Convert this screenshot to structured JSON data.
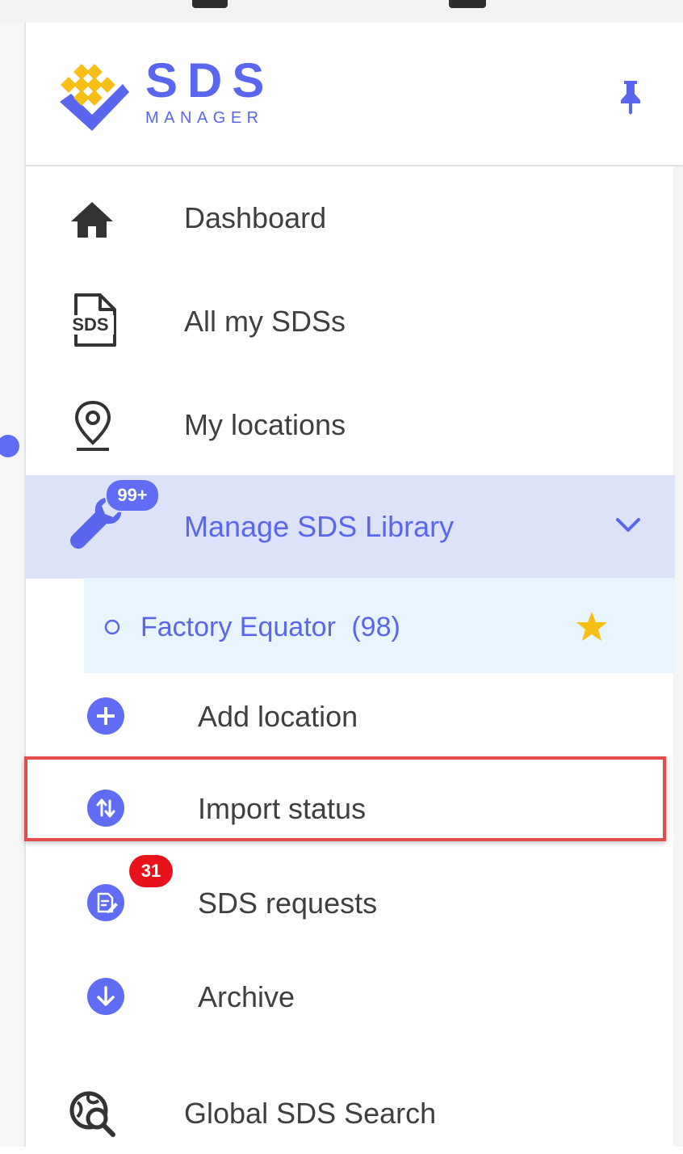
{
  "app": {
    "logo_title": "SDS",
    "logo_subtitle": "MANAGER"
  },
  "colors": {
    "accent": "#5a66ee",
    "active_bg": "#dce3f9",
    "sub_bg": "#e8f4fe",
    "highlight_border": "#e44b4b",
    "badge_red": "#e8121b",
    "star": "#f7be16"
  },
  "nav": {
    "dashboard": {
      "label": "Dashboard",
      "icon": "home-icon"
    },
    "all_sds": {
      "label": "All my SDSs",
      "icon": "sds-document-icon"
    },
    "locations": {
      "label": "My locations",
      "icon": "location-pin-icon"
    },
    "manage": {
      "label": "Manage SDS Library",
      "icon": "wrench-icon",
      "badge": "99+",
      "expanded": true
    },
    "factory": {
      "label": "Factory Equator",
      "count": "(98)",
      "favorite": true
    },
    "add_location": {
      "label": "Add location",
      "icon": "plus-circle-icon"
    },
    "import_status": {
      "label": "Import status",
      "icon": "import-arrows-icon"
    },
    "sds_requests": {
      "label": "SDS requests",
      "icon": "edit-document-icon",
      "badge": "31"
    },
    "archive": {
      "label": "Archive",
      "icon": "download-arrow-icon"
    },
    "global_search": {
      "label": "Global SDS Search",
      "icon": "global-search-icon"
    }
  }
}
